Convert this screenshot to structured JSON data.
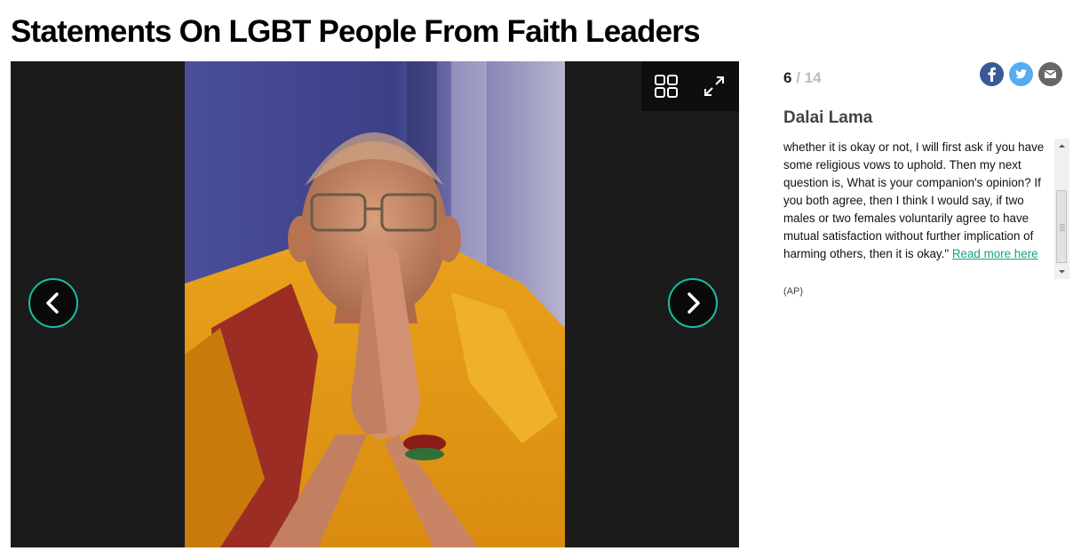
{
  "page": {
    "title": "Statements On LGBT People From Faith Leaders"
  },
  "gallery": {
    "current": "6",
    "separator": " / ",
    "total": "14",
    "image_alt": "Dalai Lama with palms pressed together",
    "buttons": {
      "grid": "grid-icon",
      "expand": "expand-icon",
      "prev": "chevron-left-icon",
      "next": "chevron-right-icon"
    }
  },
  "share": [
    {
      "name": "facebook",
      "glyph": "f",
      "color": "#3b5998"
    },
    {
      "name": "twitter",
      "color": "#55acee"
    },
    {
      "name": "email",
      "color": "#666666"
    }
  ],
  "slide": {
    "title": "Dalai Lama",
    "caption": "whether it is okay or not, I will first ask if you have some religious vows to uphold. Then my next question is, What is your companion's opinion? If you both agree, then I think I would say, if two males or two females voluntarily agree to have mutual satisfaction without further implication of harming others, then it is okay.\"",
    "link_text": "Read more here",
    "credit": "(AP)"
  },
  "colors": {
    "accent": "#16c1a4",
    "link": "#16a085",
    "viewer_bg": "#1b1b1b"
  }
}
